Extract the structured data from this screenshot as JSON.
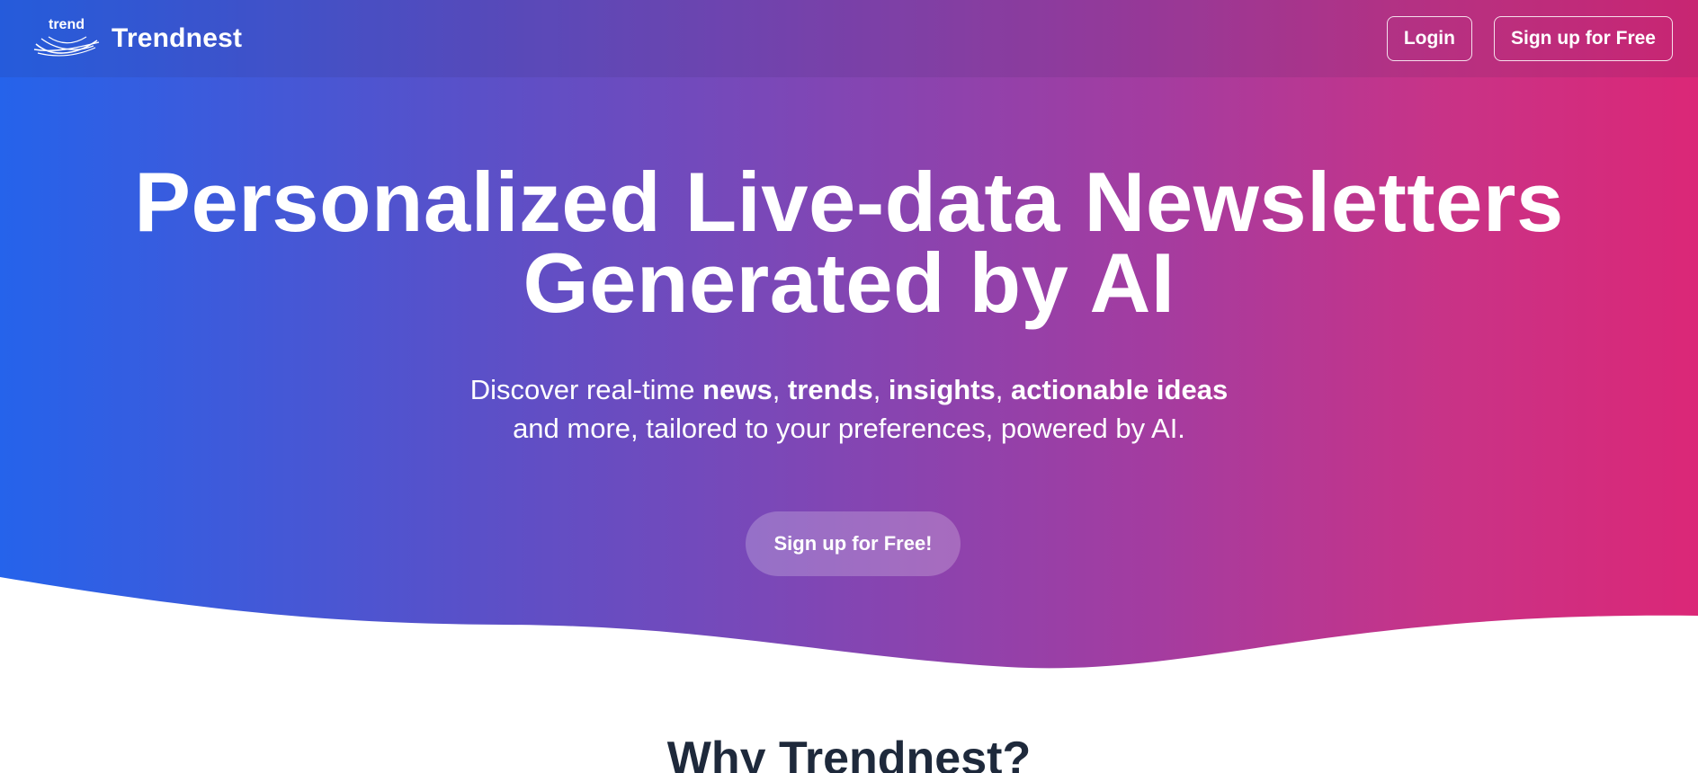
{
  "navbar": {
    "logo_text": "trend",
    "brand_name": "Trendnest",
    "login_label": "Login",
    "signup_label": "Sign up for Free"
  },
  "hero": {
    "headline_line1": "Personalized Live-data Newsletters",
    "headline_line2": "Generated by AI",
    "sub_prefix": "Discover real-time ",
    "sub_kw1": "news",
    "sub_sep1": ", ",
    "sub_kw2": "trends",
    "sub_sep2": ", ",
    "sub_kw3": "insights",
    "sub_sep3": ", ",
    "sub_kw4": "actionable ideas",
    "sub_line2": "and more, tailored to your preferences, powered by AI.",
    "cta_label": "Sign up for Free!"
  },
  "section": {
    "title": "Why Trendnest?"
  },
  "colors": {
    "gradient_start": "#2563eb",
    "gradient_end": "#db2777",
    "heading_dark": "#1e293b"
  }
}
